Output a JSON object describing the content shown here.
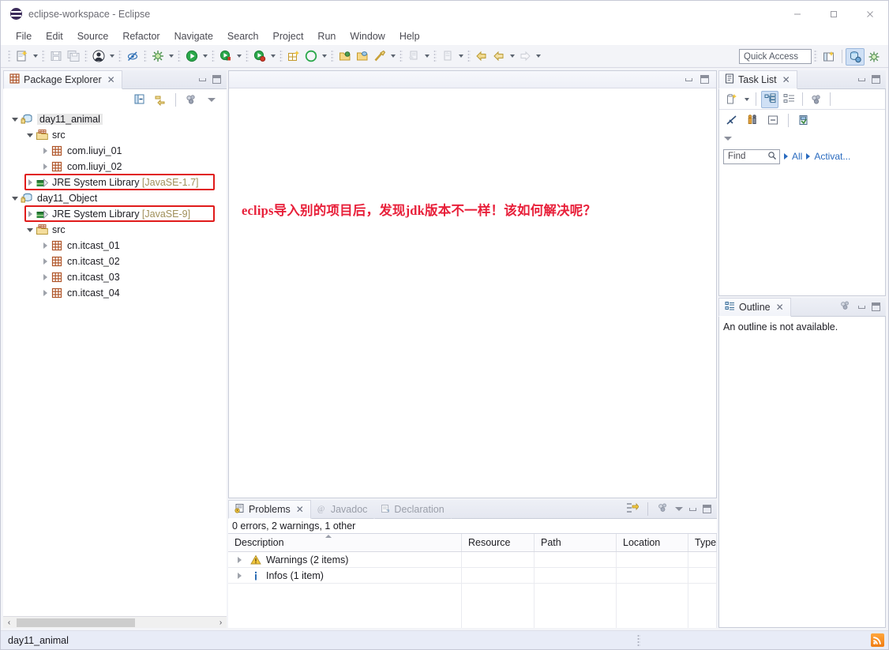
{
  "window": {
    "title": "eclipse-workspace - Eclipse",
    "app_icon": "eclipse-icon",
    "controls": {
      "minimize": "minimize-icon",
      "maximize": "maximize-icon",
      "close": "close-icon"
    }
  },
  "menubar": {
    "items": [
      "File",
      "Edit",
      "Source",
      "Refactor",
      "Navigate",
      "Search",
      "Project",
      "Run",
      "Window",
      "Help"
    ]
  },
  "toolbar": {
    "quick_access_placeholder": "Quick Access",
    "groups": [
      {
        "icons": [
          "new-wizard-icon"
        ],
        "dropdown": true
      },
      {
        "icons": [
          "save-icon",
          "save-all-icon"
        ],
        "dropdown": false
      },
      {
        "icons": [
          "person-icon"
        ],
        "dropdown": true
      },
      {
        "icons": [
          "toggle-mark-occurrences-icon"
        ],
        "dropdown": false
      },
      {
        "icons": [
          "debug-icon"
        ],
        "dropdown": true
      },
      {
        "icons": [
          "run-icon"
        ],
        "dropdown": true
      },
      {
        "icons": [
          "coverage-icon"
        ],
        "dropdown": true
      },
      {
        "icons": [
          "external-tools-icon"
        ],
        "dropdown": true
      },
      {
        "icons": [
          "new-package-icon",
          "new-java-project-icon"
        ],
        "dropdown": true
      },
      {
        "icons": [
          "open-type-icon",
          "open-task-icon",
          "search-icon"
        ],
        "dropdown": true
      },
      {
        "icons": [
          "next-annotation-icon"
        ],
        "dropdown": true
      },
      {
        "icons": [
          "previous-annotation-icon"
        ],
        "dropdown": true
      },
      {
        "icons": [
          "back-icon",
          "forward-history-icon"
        ],
        "dropdown": true
      },
      {
        "icons": [
          "forward-icon"
        ],
        "dropdown": true
      }
    ],
    "right_icons": [
      "open-perspective-icon",
      "java-perspective-icon",
      "debug-perspective-icon"
    ]
  },
  "package_explorer": {
    "tab_label": "Package Explorer",
    "close_glyph": "✕",
    "toolbar_icons": [
      "collapse-all-icon",
      "link-with-editor-icon",
      "view-menu-icon",
      "view-dropdown-icon"
    ],
    "tree": [
      {
        "label": "day11_animal",
        "icon": "java-project-icon",
        "depth": 0,
        "twisty": "down",
        "selected": true,
        "suffix": ""
      },
      {
        "label": "src",
        "icon": "source-folder-icon",
        "depth": 1,
        "twisty": "down",
        "selected": false,
        "suffix": ""
      },
      {
        "label": "com.liuyi_01",
        "icon": "package-icon",
        "depth": 2,
        "twisty": "right",
        "selected": false,
        "suffix": ""
      },
      {
        "label": "com.liuyi_02",
        "icon": "package-icon",
        "depth": 2,
        "twisty": "right",
        "selected": false,
        "suffix": ""
      },
      {
        "label": "JRE System Library",
        "icon": "jre-library-icon",
        "depth": 1,
        "twisty": "right",
        "selected": false,
        "suffix": " [JavaSE-1.7]",
        "highlight_box": true
      },
      {
        "label": "day11_Object",
        "icon": "java-project-icon",
        "depth": 0,
        "twisty": "down",
        "selected": false,
        "suffix": ""
      },
      {
        "label": "JRE System Library",
        "icon": "jre-library-icon",
        "depth": 1,
        "twisty": "right",
        "selected": false,
        "suffix": " [JavaSE-9]",
        "highlight_box": true
      },
      {
        "label": "src",
        "icon": "source-folder-icon",
        "depth": 1,
        "twisty": "down",
        "selected": false,
        "suffix": ""
      },
      {
        "label": "cn.itcast_01",
        "icon": "package-icon",
        "depth": 2,
        "twisty": "right",
        "selected": false,
        "suffix": ""
      },
      {
        "label": "cn.itcast_02",
        "icon": "package-icon",
        "depth": 2,
        "twisty": "right",
        "selected": false,
        "suffix": ""
      },
      {
        "label": "cn.itcast_03",
        "icon": "package-icon",
        "depth": 2,
        "twisty": "right",
        "selected": false,
        "suffix": ""
      },
      {
        "label": "cn.itcast_04",
        "icon": "package-icon",
        "depth": 2,
        "twisty": "right",
        "selected": false,
        "suffix": ""
      }
    ],
    "hscroll": {
      "left_arrow": "‹",
      "right_arrow": "›"
    }
  },
  "editor": {
    "annotation_text": "eclips导入别的项目后，发现jdk版本不一样！该如何解决呢？",
    "annotation_color": "#e8203a",
    "controls": [
      "minimize-icon",
      "maximize-icon"
    ]
  },
  "problems": {
    "tabs": [
      {
        "label": "Problems",
        "icon": "problems-icon",
        "active": true,
        "close_glyph": "✕"
      },
      {
        "label": "Javadoc",
        "icon": "javadoc-icon",
        "active": false,
        "close_glyph": ""
      },
      {
        "label": "Declaration",
        "icon": "declaration-icon",
        "active": false,
        "close_glyph": ""
      }
    ],
    "toolbar_icons": [
      "focus-on-selection-icon",
      "view-menu-icon",
      "view-dropdown-icon",
      "minimize-icon",
      "maximize-icon"
    ],
    "summary": "0 errors, 2 warnings, 1 other",
    "columns": [
      "Description",
      "Resource",
      "Path",
      "Location",
      "Type"
    ],
    "sorted_column": "Description",
    "rows": [
      {
        "icon": "warning-icon",
        "description": "Warnings (2 items)",
        "resource": "",
        "path": "",
        "location": "",
        "type": "",
        "twisty": "right"
      },
      {
        "icon": "info-icon",
        "description": "Infos (1 item)",
        "resource": "",
        "path": "",
        "location": "",
        "type": "",
        "twisty": "right"
      }
    ]
  },
  "task_list": {
    "tab_label": "Task List",
    "close_glyph": "✕",
    "toolbar_row1": [
      "new-task-icon",
      "new-task-dropdown-icon",
      "categorized-presentation-icon",
      "scheduled-presentation-icon",
      "focus-on-workweek-icon"
    ],
    "toolbar_row2": [
      "synchronize-changed-icon",
      "collapse-all-icon",
      "filter-completed-icon",
      "activate-task-icon"
    ],
    "toolbar_row3": [
      "view-dropdown-icon"
    ],
    "find_placeholder": "Find",
    "search_icon": "search-icon",
    "links": [
      "All",
      "Activat..."
    ],
    "controls": [
      "minimize-icon",
      "maximize-icon"
    ]
  },
  "outline": {
    "tab_label": "Outline",
    "close_glyph": "✕",
    "message": "An outline is not available.",
    "toolbar_icons": [
      "view-menu-icon"
    ],
    "controls": [
      "minimize-icon",
      "maximize-icon"
    ]
  },
  "statusbar": {
    "text": "day11_animal",
    "rss_icon": "rss-icon"
  }
}
